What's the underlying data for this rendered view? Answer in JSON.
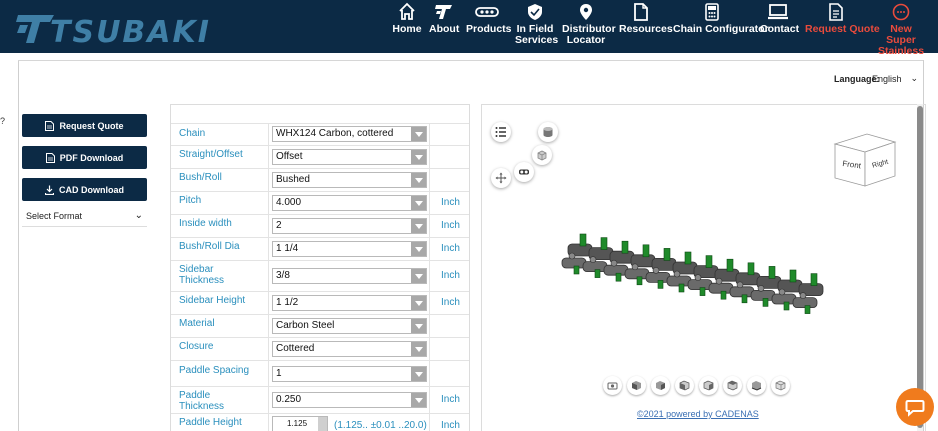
{
  "header": {
    "logo_text": "TSUBAKI",
    "nav": [
      {
        "label": "Home",
        "icon": "home-icon"
      },
      {
        "label": "About",
        "icon": "tsubaki-t-icon"
      },
      {
        "label": "Products",
        "icon": "chain-icon"
      },
      {
        "label": "In Field Services",
        "icon": "shield-icon"
      },
      {
        "label": "Distributor Locator",
        "icon": "map-pin-icon"
      },
      {
        "label": "Resources",
        "icon": "document-icon"
      },
      {
        "label": "Chain Configurator",
        "icon": "calculator-icon"
      },
      {
        "label": "Contact",
        "icon": "laptop-icon"
      },
      {
        "label": "Request Quote",
        "icon": "quote-icon"
      },
      {
        "label": "New Super Stainless",
        "icon": "super-stainless-icon"
      }
    ],
    "colors": {
      "background": "#0c2a45",
      "accent_red": "#e94b3c"
    }
  },
  "language": {
    "label": "Language:",
    "value": "English"
  },
  "actions": {
    "request_quote": "Request Quote",
    "pdf_download": "PDF Download",
    "cad_download": "CAD Download",
    "select_format": "Select Format"
  },
  "form": {
    "rows": [
      {
        "label": "Chain",
        "value": "WHX124 Carbon, cottered",
        "unit": ""
      },
      {
        "label": "Straight/Offset",
        "value": "Offset",
        "unit": ""
      },
      {
        "label": "Bush/Roll",
        "value": "Bushed",
        "unit": ""
      },
      {
        "label": "Pitch",
        "value": "4.000",
        "unit": "Inch"
      },
      {
        "label": "Inside width",
        "value": "2",
        "unit": "Inch"
      },
      {
        "label": "Bush/Roll Dia",
        "value": "1 1/4",
        "unit": "Inch"
      },
      {
        "label": "Sidebar Thickness",
        "value": "3/8",
        "unit": "Inch"
      },
      {
        "label": "Sidebar Height",
        "value": "1 1/2",
        "unit": "Inch"
      },
      {
        "label": "Material",
        "value": "Carbon Steel",
        "unit": ""
      },
      {
        "label": "Closure",
        "value": "Cottered",
        "unit": ""
      },
      {
        "label": "Paddle Spacing",
        "value": "1",
        "unit": ""
      },
      {
        "label": "Paddle Thickness",
        "value": "0.250",
        "unit": "Inch"
      }
    ],
    "paddle_height": {
      "label": "Paddle Height",
      "value": "1.125",
      "range": "(1.125.. ±0.01 ..20.0)",
      "unit": "Inch"
    }
  },
  "viewer": {
    "cube_front": "Front",
    "cube_right": "Right",
    "powered_by": "©2021 powered by CADENAS",
    "colors": {
      "chain": "#555555",
      "paddle": "#1f8a2a"
    }
  },
  "chat": {
    "icon": "chat-bubble-icon",
    "color": "#f07b1d"
  }
}
